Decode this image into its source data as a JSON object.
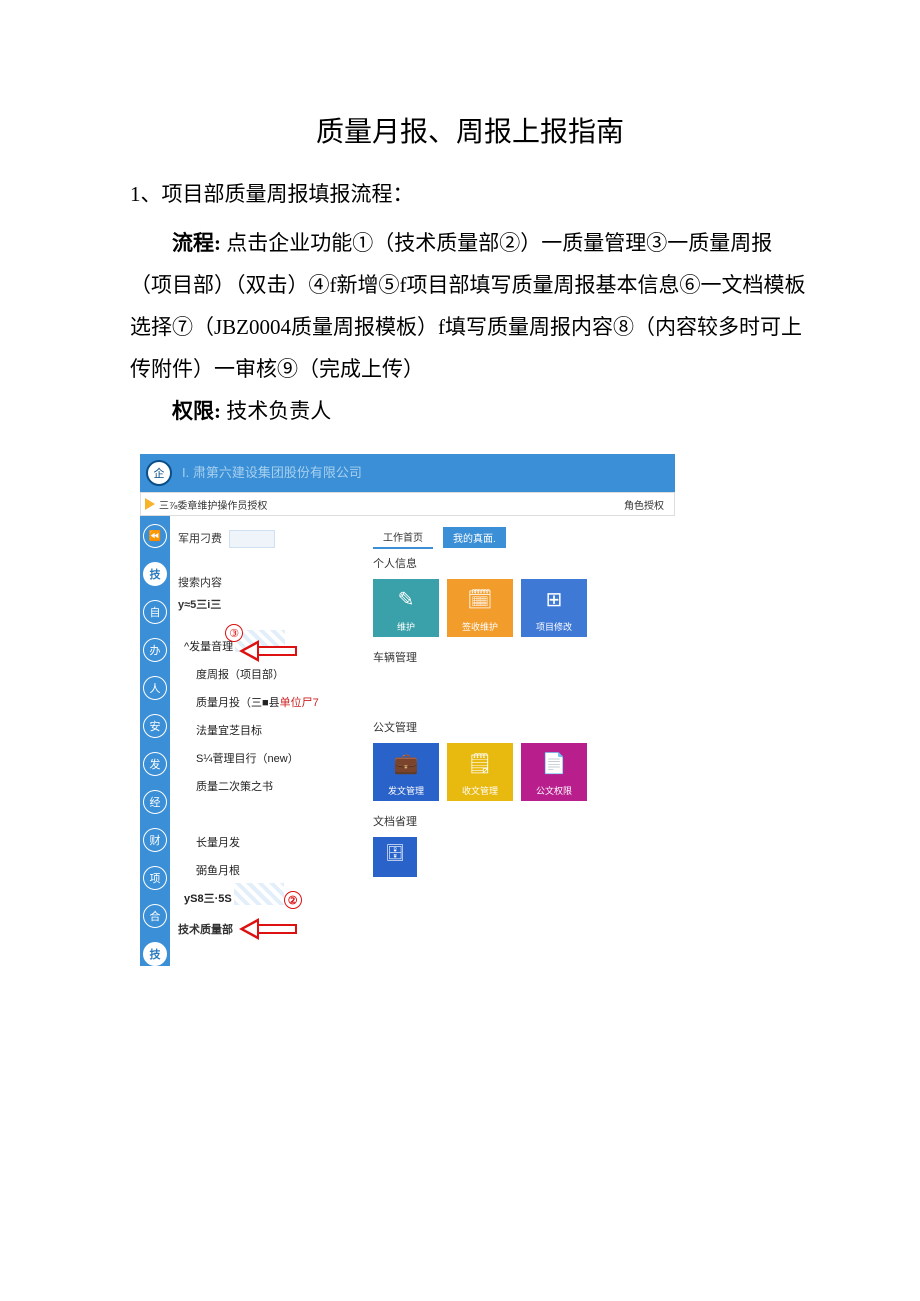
{
  "title": "质量月报、周报上报指南",
  "section1_heading": "1、项目部质量周报填报流程：",
  "para_label_process": "流程:",
  "para_process": " 点击企业功能①（技术质量部②）一质量管理③一质量周报（项目部）（双击）④f新增⑤f项目部填写质量周报基本信息⑥一文档模板选择⑦（JBZ0004质量周报模板）f填写质量周报内容⑧（内容较多时可上传附件）一审核⑨（完成上传）",
  "para_label_perm": "权限:",
  "para_perm": " 技术负责人",
  "app": {
    "org_name": "I. 肃第六建设集团股份有限公司",
    "toolbar_item": "三⅞委章维护操作员授权",
    "toolbar_role": "角色授权",
    "fee_label": "军用刁费",
    "search_label": "搜索内容",
    "search_sub": "y≈5三i三",
    "menu": {
      "m1": "^发量音理",
      "m2": "度周报（项目部）",
      "m3": "质量月投（三■县",
      "m3_red": "单位尸7",
      "m4": "法量宜芝目标",
      "m5": "S¼菅理目行（new）",
      "m6": "质量二次策之书",
      "g2a": "长量月发",
      "g2b": "弼鱼月根",
      "g2c": "yS8三·5S",
      "dept": "技术质量部"
    },
    "badges": {
      "b2": "②",
      "b3": "③"
    },
    "rail": [
      "技",
      "自",
      "办",
      "人",
      "安",
      "发",
      "经",
      "财",
      "项",
      "合",
      "技"
    ],
    "tabs": {
      "home": "工作首页",
      "my": "我的真面."
    },
    "sections": {
      "personal": "个人信息",
      "vehicle": "车辆管理",
      "doc": "公文管理",
      "archive": "文档省理"
    },
    "tiles": {
      "t1": "维护",
      "t2": "签收维护",
      "t3": "项目修改",
      "d1": "发文管理",
      "d2": "收文管理",
      "d3": "公文权限"
    }
  }
}
